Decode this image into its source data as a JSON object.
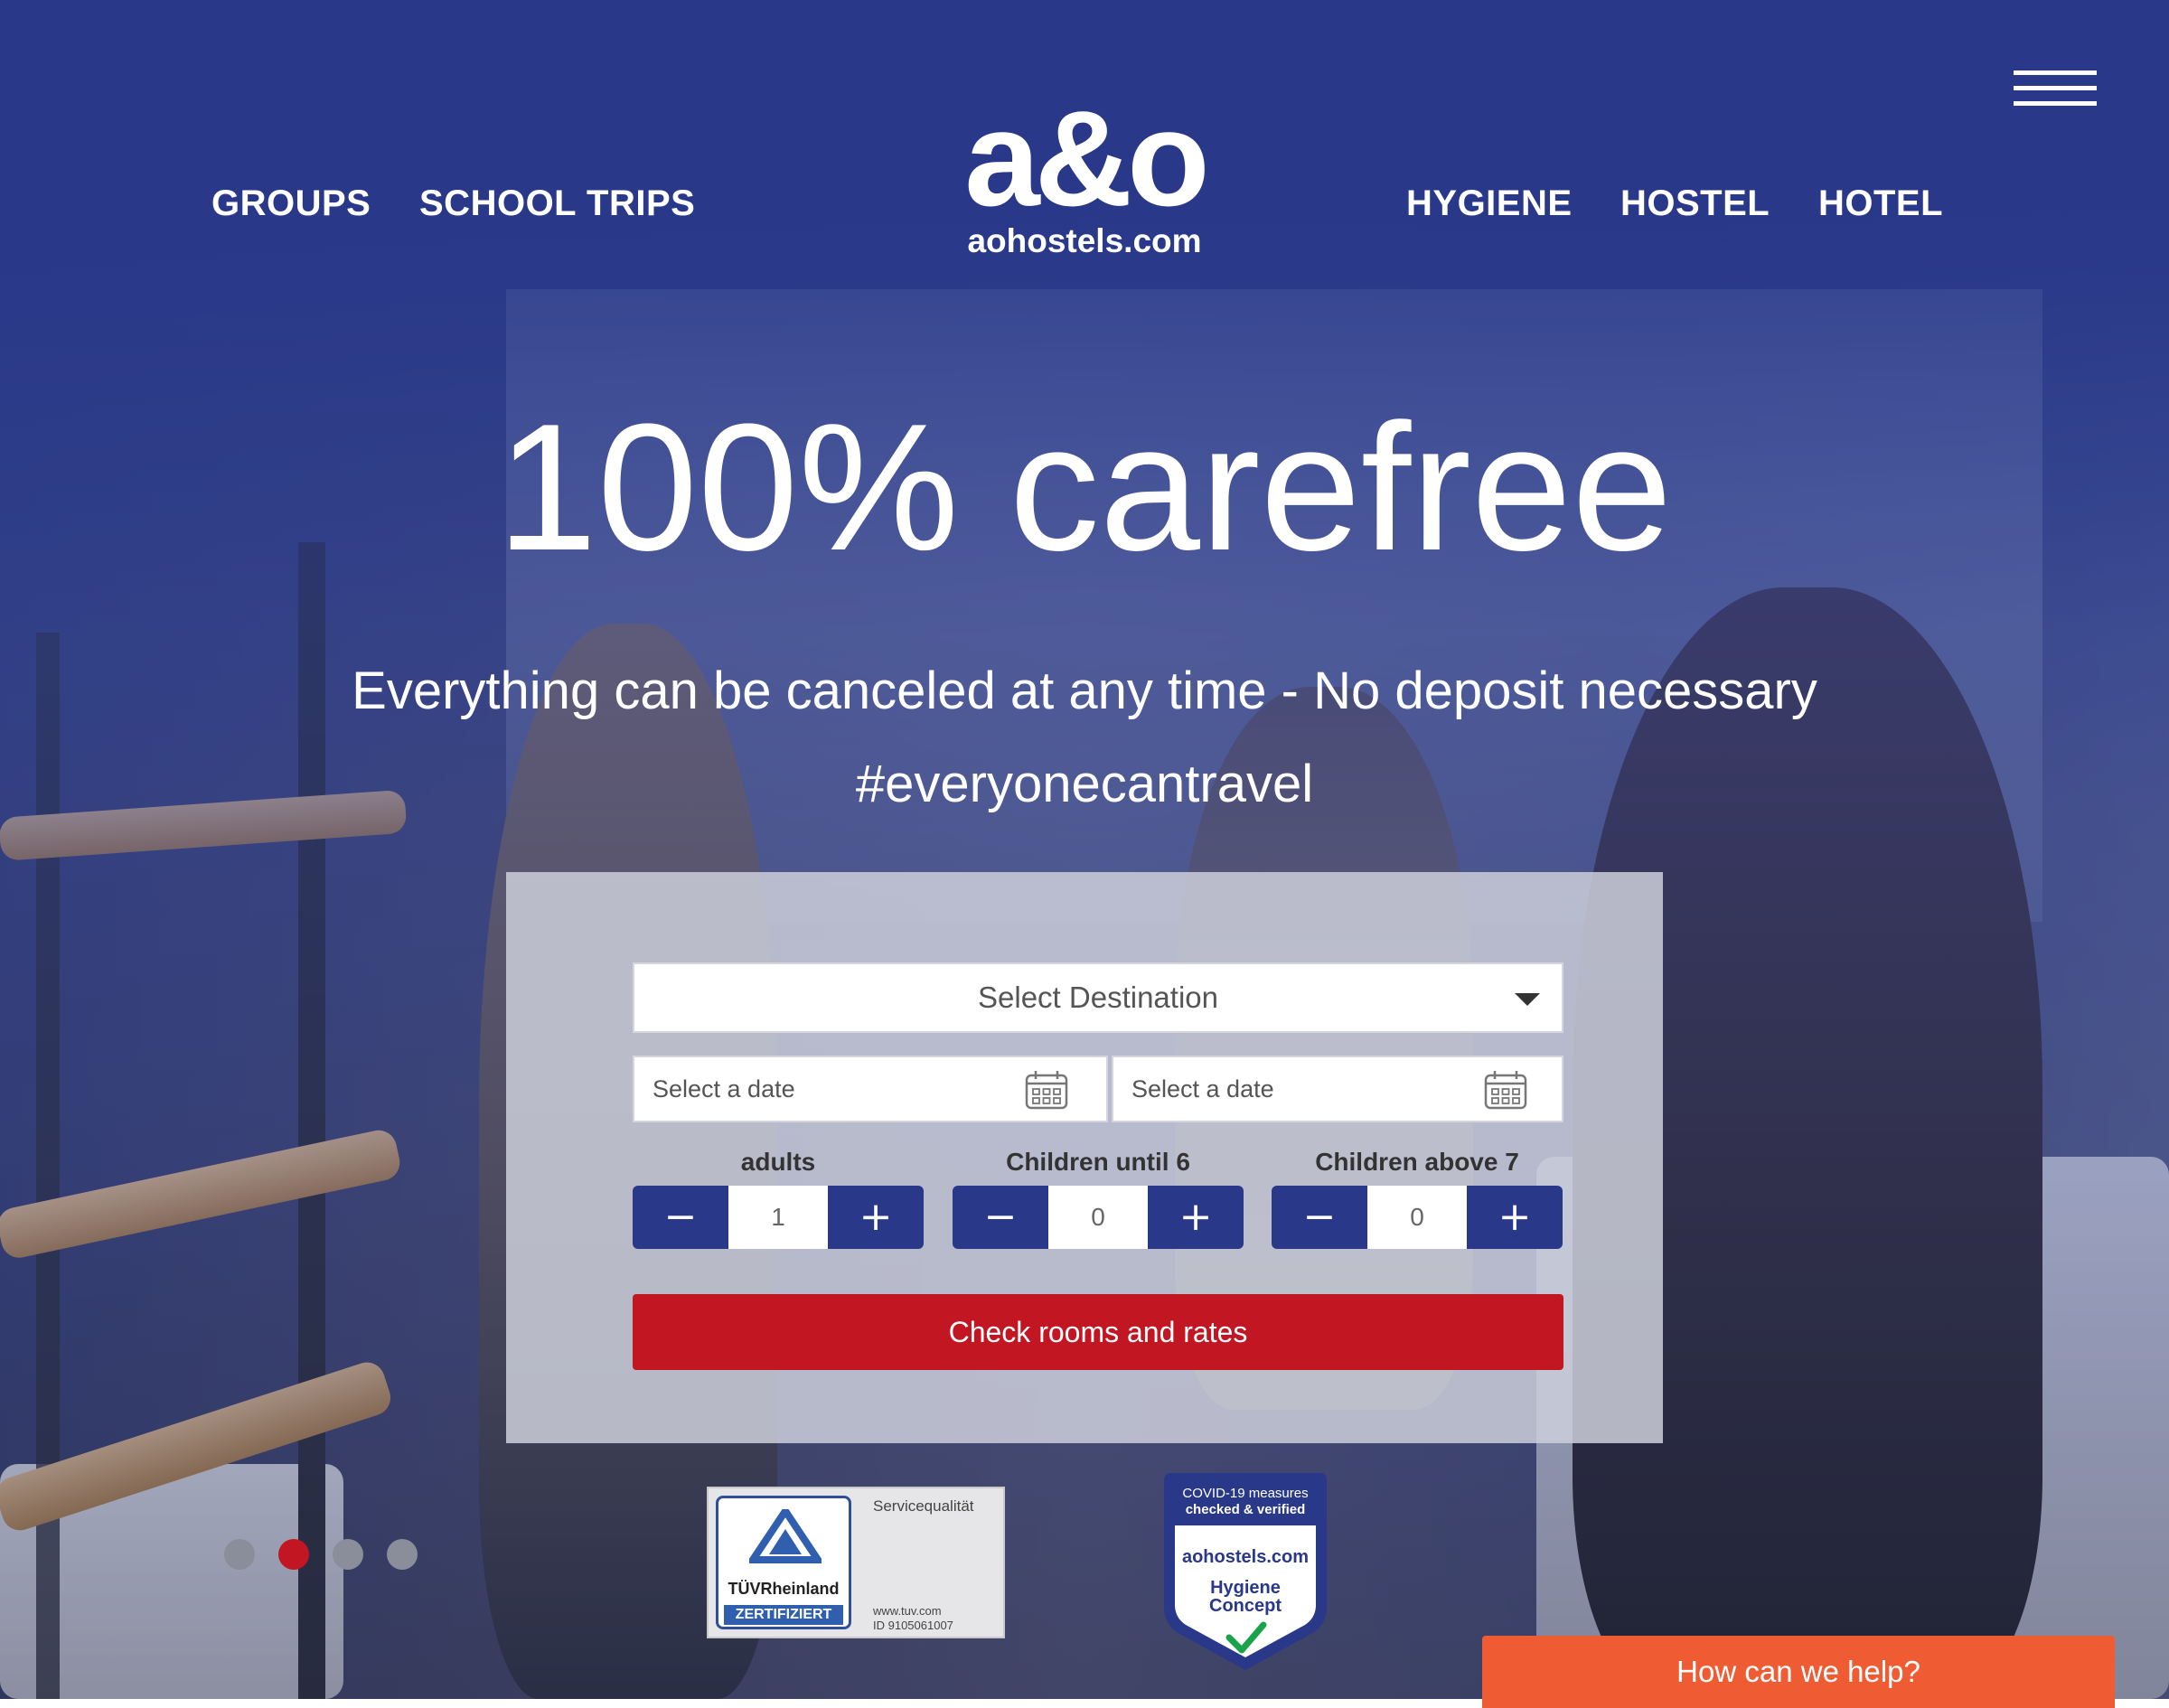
{
  "brand": {
    "logo_text": "a&o",
    "domain": "aohostels.com"
  },
  "nav": {
    "left": [
      "GROUPS",
      "SCHOOL TRIPS"
    ],
    "right": [
      "HYGIENE",
      "HOSTEL",
      "HOTEL"
    ],
    "menu_icon": "hamburger-icon"
  },
  "hero": {
    "headline": "100% carefree",
    "subline": "Everything can be canceled at any time - No deposit necessary",
    "hashtag": "#everyonecantravel"
  },
  "booking": {
    "destination_placeholder": "Select Destination",
    "checkin_placeholder": "Select a date",
    "checkout_placeholder": "Select a date",
    "counters": [
      {
        "label": "adults",
        "value": "1"
      },
      {
        "label": "Children until 6",
        "value": "0"
      },
      {
        "label": "Children above 7",
        "value": "0"
      }
    ],
    "decrement_symbol": "−",
    "increment_symbol": "+",
    "submit_label": "Check rooms and rates"
  },
  "carousel": {
    "slide_count": 4,
    "active_index": 1
  },
  "badges": {
    "tuv": {
      "brand": "TÜVRheinland",
      "cert": "ZERTIFIZIERT",
      "service": "Servicequalität",
      "url": "www.tuv.com",
      "id": "ID 9105061007"
    },
    "hygiene": {
      "line1": "COVID-19 measures",
      "line2": "checked & verified",
      "domain": "aohostels.com",
      "title1": "Hygiene",
      "title2": "Concept"
    }
  },
  "help_widget": {
    "label": "How can we help?"
  },
  "colors": {
    "brand_blue": "#293889",
    "cta_red": "#c21622",
    "help_orange": "#ef5c33"
  }
}
